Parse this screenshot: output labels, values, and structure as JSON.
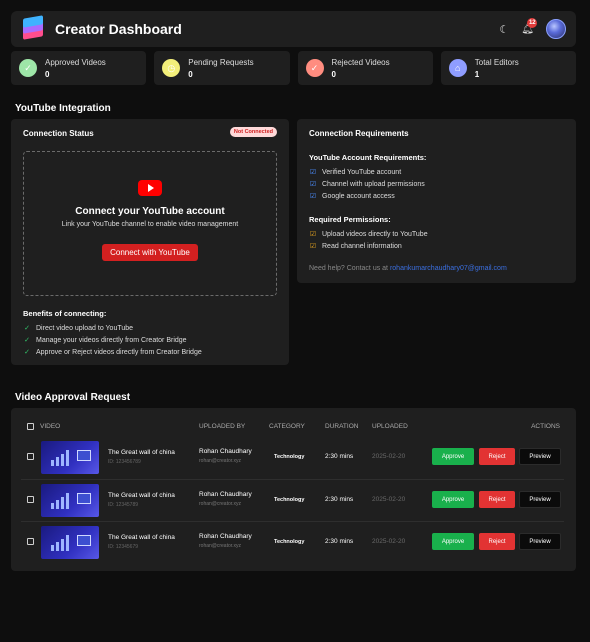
{
  "header": {
    "title": "Creator Dashboard",
    "notification_count": "12"
  },
  "stats": [
    {
      "label": "Approved Videos",
      "value": "0",
      "color": "#9ee6a8",
      "icon": "check-circle-icon"
    },
    {
      "label": "Pending Requests",
      "value": "0",
      "color": "#f3ef7a",
      "icon": "clock-icon"
    },
    {
      "label": "Rejected Videos",
      "value": "0",
      "color": "#ff8d80",
      "icon": "x-circle-icon"
    },
    {
      "label": "Total Editors",
      "value": "1",
      "color": "#8f9dff",
      "icon": "home-icon"
    }
  ],
  "integration": {
    "section_title": "YouTube Integration",
    "status_title": "Connection Status",
    "status_badge": "Not Connected",
    "connect_title": "Connect your YouTube account",
    "connect_subtitle": "Link your YouTube channel to enable video management",
    "connect_button": "Connect with YouTube",
    "benefits_title": "Benefits of connecting:",
    "benefits": [
      "Direct video upload to YouTube",
      "Manage your videos directly from Creator Bridge",
      "Approve or Reject videos directly from Creator Bridge"
    ]
  },
  "requirements": {
    "title": "Connection Requirements",
    "account_title": "YouTube Account Requirements:",
    "account_items": [
      "Verified YouTube account",
      "Channel with upload permissions",
      "Google account access"
    ],
    "permissions_title": "Required Permissions:",
    "permissions_items": [
      "Upload videos directly to YouTube",
      "Read channel information"
    ],
    "help_text": "Need help? Contact us at ",
    "help_email": "rohankumarchaudhary07@gmail.com"
  },
  "approvals": {
    "section_title": "Video Approval Request",
    "columns": [
      "VIDEO",
      "UPLOADED BY",
      "CATEGORY",
      "DURATION",
      "UPLOADED",
      "ACTIONS"
    ],
    "rows": [
      {
        "title": "The Great wall of china",
        "id": "ID: 123456789",
        "uploader": "Rohan Chaudhary",
        "email": "rohan@creator.xyz",
        "category": "Technology",
        "duration": "2:30 mins",
        "date": "2025-02-20"
      },
      {
        "title": "The Great wall of china",
        "id": "ID: 12345789",
        "uploader": "Rohan Chaudhary",
        "email": "rohan@creator.xyz",
        "category": "Technology",
        "duration": "2:30 mins",
        "date": "2025-02-20"
      },
      {
        "title": "The Great wall of china",
        "id": "ID: 12345679",
        "uploader": "Rohan Chaudhary",
        "email": "rohan@creator.xyz",
        "category": "Technology",
        "duration": "2:30 mins",
        "date": "2025-02-20"
      }
    ],
    "approve_label": "Approve",
    "reject_label": "Reject",
    "preview_label": "Preview"
  }
}
